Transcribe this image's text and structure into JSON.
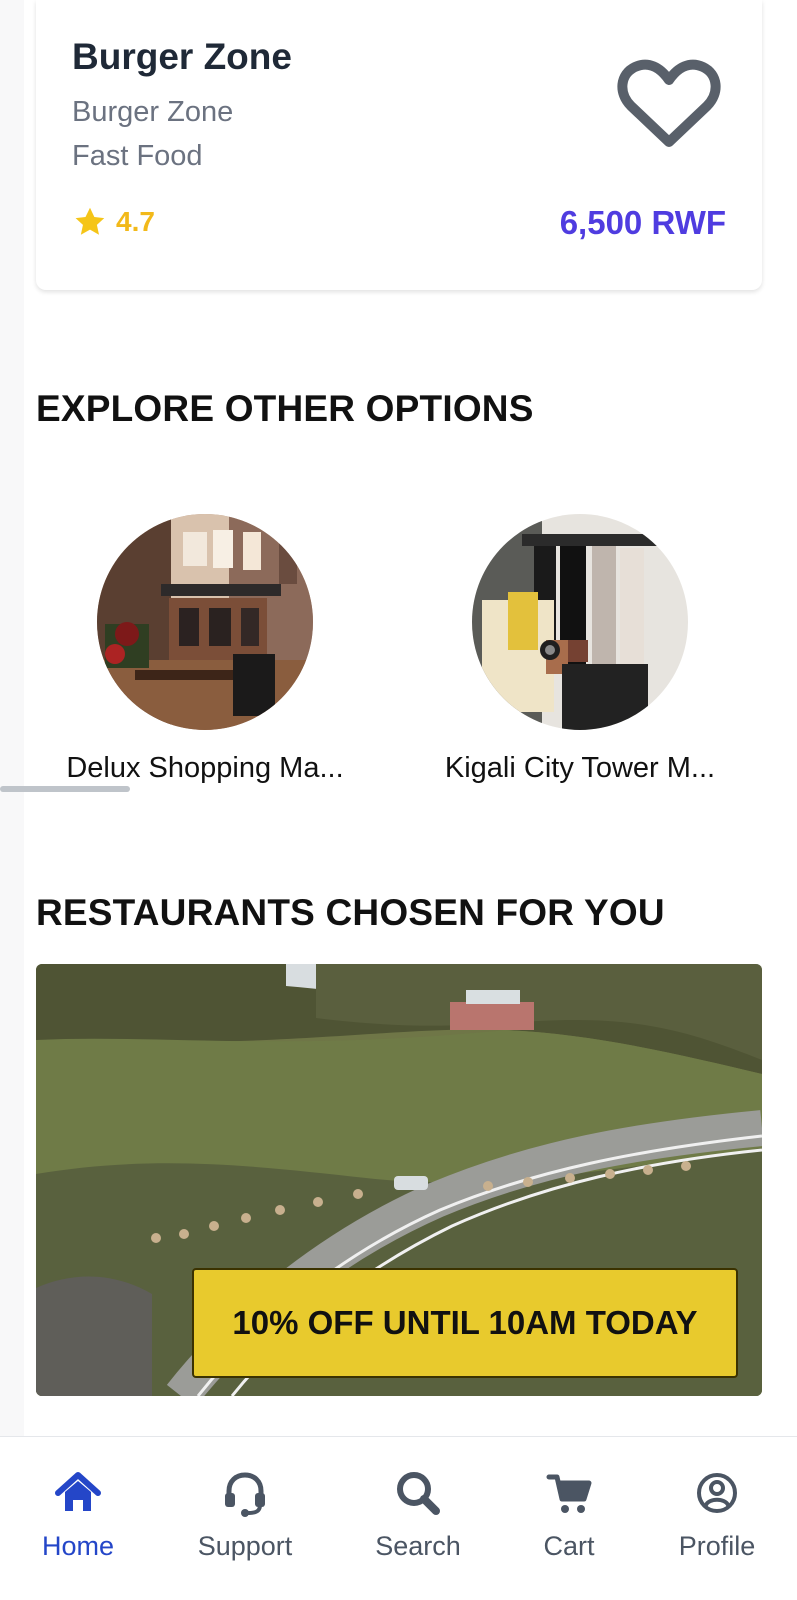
{
  "product": {
    "name": "Burger Zone",
    "restaurant": "Burger Zone",
    "category": "Fast Food",
    "rating": "4.7",
    "price": "6,500 RWF"
  },
  "explore": {
    "title": "EXPLORE OTHER OPTIONS",
    "items": [
      {
        "label": "Delux Shopping Ma..."
      },
      {
        "label": "Kigali City Tower M..."
      }
    ]
  },
  "restaurants": {
    "title": "RESTAURANTS CHOSEN FOR YOU",
    "promo": "10% OFF UNTIL 10AM TODAY"
  },
  "nav": {
    "items": [
      {
        "label": "Home",
        "icon": "home-icon",
        "active": true
      },
      {
        "label": "Support",
        "icon": "headset-icon",
        "active": false
      },
      {
        "label": "Search",
        "icon": "search-icon",
        "active": false
      },
      {
        "label": "Cart",
        "icon": "cart-icon",
        "active": false
      },
      {
        "label": "Profile",
        "icon": "profile-icon",
        "active": false
      }
    ]
  },
  "colors": {
    "accent": "#4f3ce0",
    "nav_active": "#2446c8",
    "rating": "#f2b91a",
    "promo_bg": "#e8ca2d"
  }
}
